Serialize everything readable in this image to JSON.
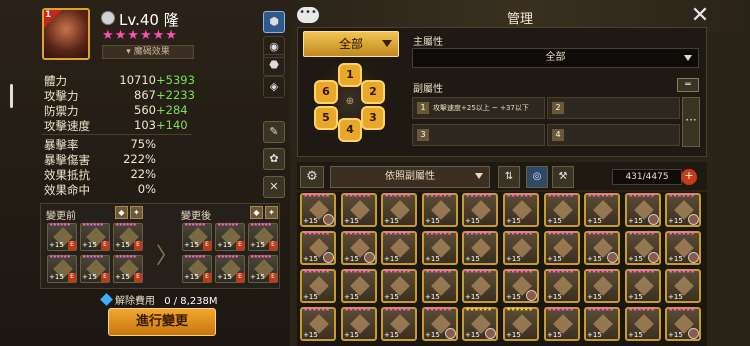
{
  "hero": {
    "level_label": "Lv.40",
    "name": "隆",
    "stars": "★★★★★★",
    "skill_effect": "魔碣效果",
    "avatar_level": "1"
  },
  "stats": [
    {
      "label": "體力",
      "value": "10710",
      "bonus": "+5393"
    },
    {
      "label": "攻擊力",
      "value": "867",
      "bonus": "+2233"
    },
    {
      "label": "防禦力",
      "value": "560",
      "bonus": "+284"
    },
    {
      "label": "攻擊速度",
      "value": "103",
      "bonus": "+140"
    },
    {
      "label": "暴擊率",
      "value": "75%",
      "bonus": ""
    },
    {
      "label": "暴擊傷害",
      "value": "222%",
      "bonus": ""
    },
    {
      "label": "效果抵抗",
      "value": "22%",
      "bonus": ""
    },
    {
      "label": "效果命中",
      "value": "0%",
      "bonus": ""
    }
  ],
  "change": {
    "before_label": "變更前",
    "after_label": "變更後",
    "rune_plus": "+15",
    "tag": "E",
    "cost_label": "解除費用",
    "cost_value": "0 / 8,238M",
    "execute_label": "進行變更"
  },
  "panel": {
    "title": "管理",
    "set_label": "全部",
    "slots": [
      "1",
      "2",
      "3",
      "4",
      "5",
      "6"
    ],
    "main_attr_label": "主屬性",
    "main_attr_value": "全部",
    "sub_attr_label": "副屬性",
    "sub_slots": [
      {
        "n": "1",
        "text": "攻擊速度+25以上 ~ +37以下"
      },
      {
        "n": "2",
        "text": ""
      },
      {
        "n": "3",
        "text": ""
      },
      {
        "n": "4",
        "text": ""
      }
    ],
    "more_label": "···",
    "sort_label": "依照副屬性",
    "count": "431/4475",
    "plus": "+"
  },
  "inventory": {
    "rune_plus": "+15",
    "stars": "★★★★★★"
  }
}
